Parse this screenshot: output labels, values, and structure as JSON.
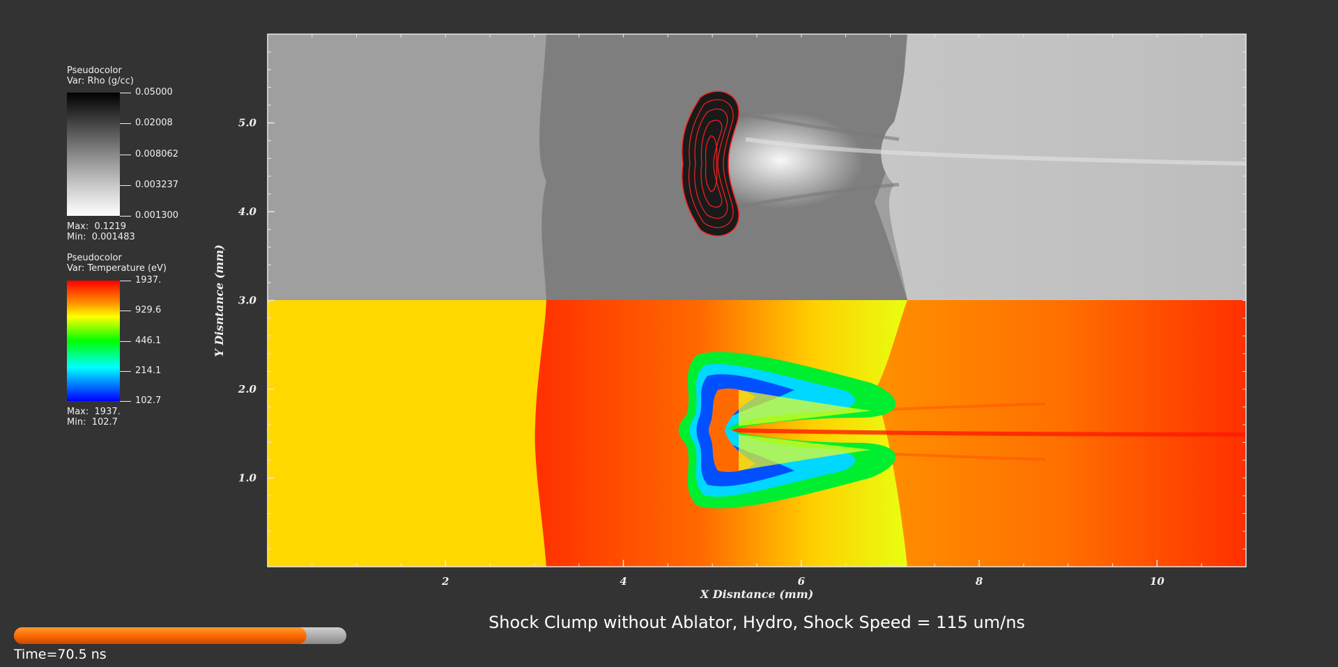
{
  "legends": [
    {
      "title": "Pseudocolor",
      "var": "Var: Rho (g/cc)",
      "ticks": [
        "0.05000",
        "0.02008",
        "0.008062",
        "0.003237",
        "0.001300"
      ],
      "max_label": "Max:",
      "max_value": "0.1219",
      "min_label": "Min:",
      "min_value": "0.001483",
      "colormap": "gray"
    },
    {
      "title": "Pseudocolor",
      "var": "Var: Temperature (eV)",
      "ticks": [
        "1937.",
        "929.6",
        "446.1",
        "214.1",
        "102.7"
      ],
      "max_label": "Max:",
      "max_value": "1937.",
      "min_label": "Min:",
      "min_value": "102.7",
      "colormap": "hot-to-cold"
    }
  ],
  "chart_data": {
    "type": "heatmap",
    "title": "Shock Clump without Ablator, Hydro, Shock Speed = 115 um/ns",
    "xlabel": "X Disntance (mm)",
    "ylabel": "Y Disntance (mm)",
    "xlim": [
      0,
      11
    ],
    "ylim": [
      0,
      6
    ],
    "x_ticks": [
      "2",
      "4",
      "6",
      "8",
      "10"
    ],
    "y_ticks": [
      "1.0",
      "2.0",
      "3.0",
      "4.0",
      "5.0"
    ],
    "panels": [
      "Rho (g/cc) upper half, y 3.0–6.0",
      "Temperature (eV) lower half, y 0–3.0"
    ],
    "shock_front_x_mm": 3.1,
    "clump_center_x_mm": 5.0
  },
  "time_slider": {
    "progress": 0.88,
    "label": "Time=70.5 ns"
  },
  "colors": {
    "background": "#333333",
    "slider_fill": "#ff7a00",
    "contour": "#ff2020"
  }
}
